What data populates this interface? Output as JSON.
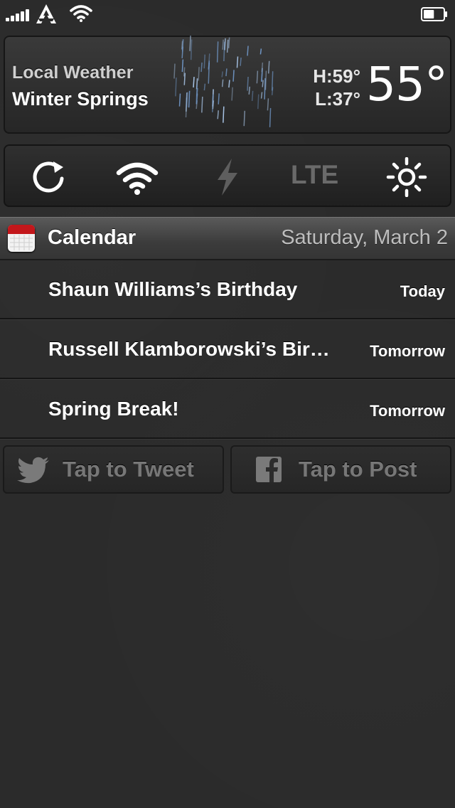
{
  "status_bar": {
    "signal_bars": 5,
    "icons": [
      "signal-icon",
      "carrier-logo-icon",
      "wifi-icon",
      "battery-icon"
    ],
    "battery_level": 0.55
  },
  "weather": {
    "line1": "Local Weather",
    "line2": "Winter Springs",
    "high": "H:59°",
    "low": "L:37°",
    "temperature": "55°",
    "condition_icon": "rain-icon"
  },
  "toggles": [
    {
      "name": "rotation-lock-icon",
      "active": true
    },
    {
      "name": "wifi-icon",
      "active": true
    },
    {
      "name": "flash-icon",
      "active": false
    },
    {
      "name": "lte-toggle",
      "label": "LTE",
      "active": false
    },
    {
      "name": "brightness-icon",
      "active": true
    }
  ],
  "calendar": {
    "title": "Calendar",
    "date": "Saturday, March 2",
    "events": [
      {
        "title": "Shaun Williams’s Birthday",
        "when": "Today"
      },
      {
        "title": "Russell Klamborowski’s Bir…",
        "when": "Tomorrow"
      },
      {
        "title": "Spring Break!",
        "when": "Tomorrow"
      }
    ]
  },
  "social": {
    "tweet_label": "Tap to Tweet",
    "post_label": "Tap to Post"
  },
  "colors": {
    "background": "#2b2b2b",
    "calendar_red": "#c3171b",
    "disabled_text": "#777777",
    "lte_disabled": "#6a6a6a"
  }
}
